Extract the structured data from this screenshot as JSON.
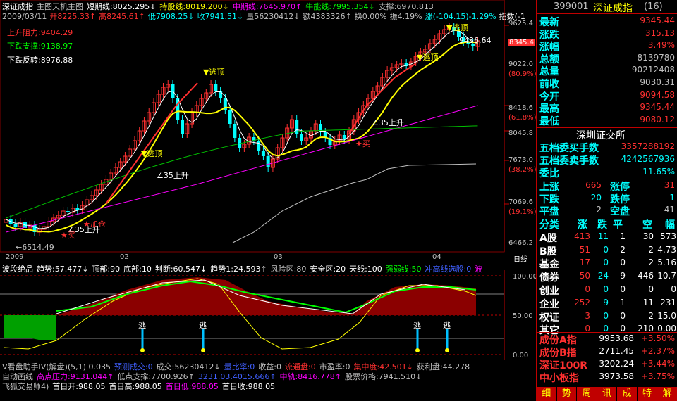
{
  "header": {
    "row1": [
      {
        "text": "深证成指",
        "color": "#ffffff"
      },
      {
        "text": "主图天机主图",
        "color": "#c0c0c0"
      },
      {
        "text": "短期线:8025.295↓",
        "color": "#ffffff"
      },
      {
        "text": "持股线:8019.200↓",
        "color": "#ffff00"
      },
      {
        "text": "中期线:7645.970↑",
        "color": "#ff00ff"
      },
      {
        "text": "牛能线:7995.354↓",
        "color": "#00ff00"
      },
      {
        "text": "支撑:6970.813",
        "color": "#c0c0c0"
      }
    ],
    "row2": [
      {
        "text": "2009/03/11",
        "color": "#c0c0c0"
      },
      {
        "text": "开8225.33↑",
        "color": "#ff3030"
      },
      {
        "text": "高8245.61↑",
        "color": "#ff3030"
      },
      {
        "text": "低7908.25↓",
        "color": "#00ffff"
      },
      {
        "text": "收7941.51↓",
        "color": "#00ffff"
      },
      {
        "text": "量56230412↓",
        "color": "#c0c0c0"
      },
      {
        "text": "额4383326↑",
        "color": "#c0c0c0"
      },
      {
        "text": "换0.00%",
        "color": "#c0c0c0"
      },
      {
        "text": "振4.19%",
        "color": "#c0c0c0"
      },
      {
        "text": "涨(-104.15)-1.29%",
        "color": "#00ffff"
      },
      {
        "text": "指数(-1",
        "color": "#ffffff"
      }
    ]
  },
  "levels": [
    {
      "text": "上升阻力:9404.29",
      "color": "#ff3030"
    },
    {
      "text": "下跌支撑:9138.97",
      "color": "#00ff00"
    },
    {
      "text": "下跌反转:8976.88",
      "color": "#ffffff"
    }
  ],
  "annotations": {
    "escape": "逃顶",
    "buy": "买",
    "add": "加仓",
    "rise35": "35上升",
    "max_price": "9436.64",
    "min_price": "6514.49",
    "cur_price": "8345.4"
  },
  "price_axis": [
    "9625.4",
    "9022.0",
    "(80.9%)",
    "8418.6",
    "(61.8%)",
    "8045.8",
    "7673.0",
    "(38.2%)",
    "7069.6",
    "(19.1%)",
    "6466.2"
  ],
  "date_axis": [
    "2009",
    "02",
    "03",
    "04",
    "日线"
  ],
  "sub_axis": [
    "100.00",
    "50.00",
    "0.00"
  ],
  "indicator": {
    "title_items": [
      {
        "text": "波段绝品",
        "color": "#ffffff"
      },
      {
        "text": "趋势:57.477↓",
        "color": "#ffffff"
      },
      {
        "text": "顶部:90",
        "color": "#ffffff"
      },
      {
        "text": "底部:10",
        "color": "#ffffff"
      },
      {
        "text": "判断:60.547↓",
        "color": "#ffffff"
      },
      {
        "text": "趋势1:24.593↑",
        "color": "#ffffff"
      },
      {
        "text": "风险区:80",
        "color": "#c0c0c0"
      },
      {
        "text": "安全区:20",
        "color": "#ffffff"
      },
      {
        "text": "天线:100",
        "color": "#ffffff"
      },
      {
        "text": "强弱线:50",
        "color": "#00ff00"
      },
      {
        "text": "冲高线选股:0",
        "color": "#4060ff"
      },
      {
        "text": "波",
        "color": "#ff00ff"
      }
    ],
    "escape_label": "逃"
  },
  "bottom_lines": [
    [
      {
        "text": "V看盘助手IV(解盘)(5,1) 0.035",
        "color": "#c0c0c0"
      },
      {
        "text": "预测成交:0",
        "color": "#4060ff"
      },
      {
        "text": "成交:56230412↓",
        "color": "#c0c0c0"
      },
      {
        "text": "量比率:0",
        "color": "#4060ff"
      },
      {
        "text": "收益:0",
        "color": "#c0c0c0"
      },
      {
        "text": "流通盘:0",
        "color": "#ff3030"
      },
      {
        "text": "市盈率:0",
        "color": "#c0c0c0"
      },
      {
        "text": "集中度:42.501↓",
        "color": "#ff3030"
      },
      {
        "text": "获利盘:44.278",
        "color": "#c0c0c0"
      }
    ],
    [
      {
        "text": "自动画线",
        "color": "#c0c0c0"
      },
      {
        "text": "高点压力:9131.044↑",
        "color": "#ff00ff"
      },
      {
        "text": "低点支撑:7700.926↑",
        "color": "#c0c0c0"
      },
      {
        "text": "3231.03.4015.666↑",
        "color": "#4060ff"
      },
      {
        "text": "中轨:8416.778↑",
        "color": "#ff00ff"
      },
      {
        "text": "股票价格:7941.510↓",
        "color": "#c0c0c0"
      }
    ],
    [
      {
        "text": "飞狐交易师4)",
        "color": "#c0c0c0"
      },
      {
        "text": "首日开:988.05",
        "color": "#ffffff"
      },
      {
        "text": "首日高:988.05",
        "color": "#ffffff"
      },
      {
        "text": "首日低:988.05",
        "color": "#ff00ff"
      },
      {
        "text": "首日收:988.05",
        "color": "#ffffff"
      }
    ]
  ],
  "panel": {
    "code": "399001",
    "name": "深证成指",
    "count": "(16)",
    "quotes": [
      {
        "label": "最新",
        "value": "9345.44",
        "color": "#ff3030"
      },
      {
        "label": "涨跌",
        "value": "315.13",
        "color": "#ff3030"
      },
      {
        "label": "涨幅",
        "value": "3.49%",
        "color": "#ff3030"
      },
      {
        "label": "总额",
        "value": "8139780",
        "color": "#c0c0c0"
      },
      {
        "label": "总量",
        "value": "90212408",
        "color": "#c0c0c0"
      },
      {
        "label": "前收",
        "value": "9030.31",
        "color": "#c0c0c0"
      },
      {
        "label": "今开",
        "value": "9094.58",
        "color": "#ff3030"
      },
      {
        "label": "最高",
        "value": "9345.44",
        "color": "#ff3030"
      },
      {
        "label": "最低",
        "value": "9080.12",
        "color": "#ff3030"
      }
    ],
    "exchange": "深圳证交所",
    "depth": [
      {
        "label": "五档委买手数",
        "value": "3357288192",
        "color": "#ff3030"
      },
      {
        "label": "五档委卖手数",
        "value": "4242567936",
        "color": "#00ffff"
      },
      {
        "label": "委比",
        "value": "-11.65%",
        "color": "#00ffff"
      }
    ],
    "breadth": [
      {
        "l1": "上涨",
        "v1": "665",
        "c1": "#ff3030",
        "l2": "涨停",
        "v2": "31",
        "c2": "#ff3030"
      },
      {
        "l1": "下跌",
        "v1": "20",
        "c1": "#00ffff",
        "l2": "跌停",
        "v2": "1",
        "c2": "#00ffff"
      },
      {
        "l1": "平盘",
        "v1": "2",
        "c1": "#c0c0c0",
        "l2": "空盘",
        "v2": "41",
        "c2": "#c0c0c0"
      }
    ],
    "class_header": [
      "分类",
      "涨",
      "跌",
      "平",
      "空",
      "幅"
    ],
    "classes": [
      {
        "name": "A股",
        "up": "413",
        "down": "11",
        "flat": "1",
        "empty": "30",
        "pct": "573"
      },
      {
        "name": "B股",
        "up": "51",
        "down": "0",
        "flat": "2",
        "empty": "2",
        "pct": "4.73"
      },
      {
        "name": "基金",
        "up": "17",
        "down": "0",
        "flat": "0",
        "empty": "2",
        "pct": "5.16"
      },
      {
        "name": "债券",
        "up": "50",
        "down": "24",
        "flat": "9",
        "empty": "446",
        "pct": "10.7"
      },
      {
        "name": "创业",
        "up": "0",
        "down": "0",
        "flat": "0",
        "empty": "0",
        "pct": "0"
      },
      {
        "name": "企业",
        "up": "252",
        "down": "9",
        "flat": "1",
        "empty": "11",
        "pct": "231"
      },
      {
        "name": "权证",
        "up": "3",
        "down": "0",
        "flat": "0",
        "empty": "2",
        "pct": "15.0"
      },
      {
        "name": "其它",
        "up": "0",
        "down": "0",
        "flat": "0",
        "empty": "210",
        "pct": "0.00"
      }
    ],
    "indices": [
      {
        "name": "成份A指",
        "value": "9953.68",
        "pct": "+3.50%"
      },
      {
        "name": "成份B指",
        "value": "2711.45",
        "pct": "+2.37%"
      },
      {
        "name": "深证100R",
        "value": "3202.24",
        "pct": "+3.44%"
      },
      {
        "name": "中小板指",
        "value": "3973.58",
        "pct": "+3.75%"
      }
    ],
    "tabs": [
      "细",
      "势",
      "周",
      "讯",
      "成",
      "特",
      "解"
    ]
  },
  "colors": {
    "up": "#ff3030",
    "down": "#00ffff",
    "frame": "#c00000",
    "bg": "#000000"
  }
}
